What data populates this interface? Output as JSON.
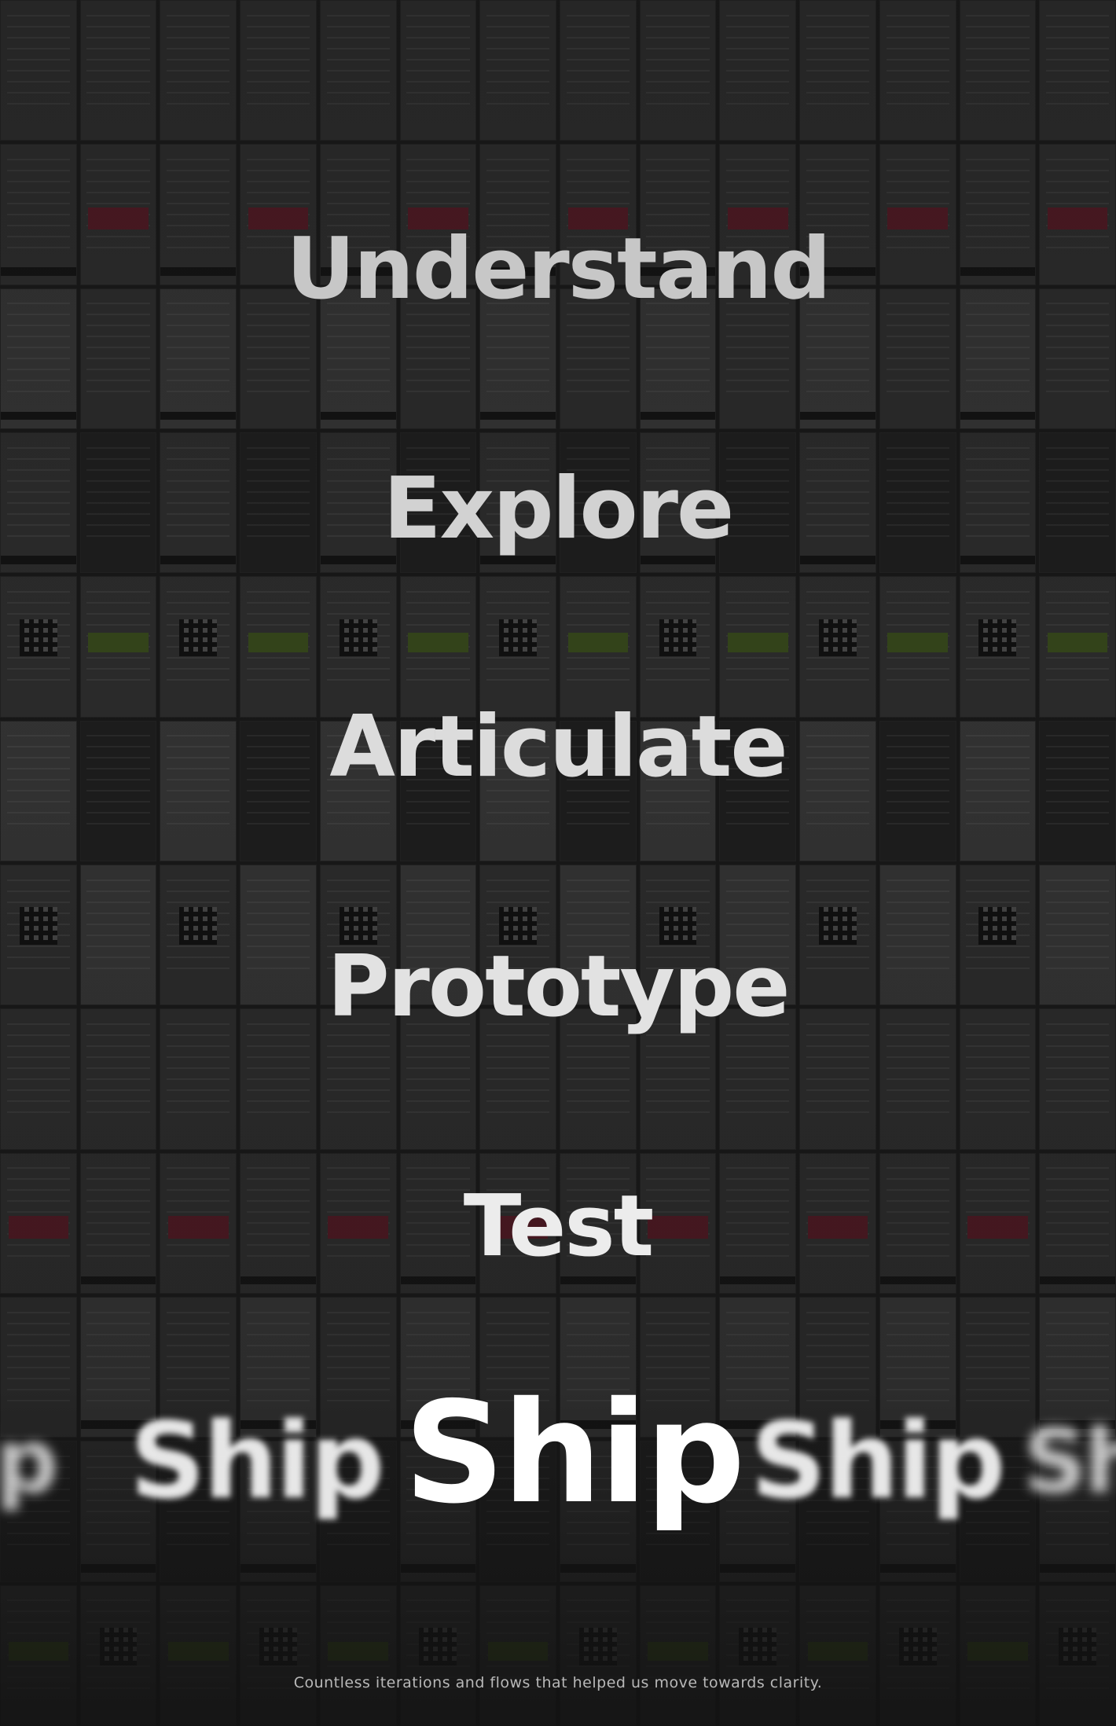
{
  "stages": [
    "Understand",
    "Explore",
    "Articulate",
    "Prototype",
    "Test"
  ],
  "ship": {
    "main": "Ship",
    "echo_near": "Ship",
    "echo_far_left": "hip",
    "echo_far_right": "Sh"
  },
  "caption": "Countless iterations and flows that helped us move towards clarity.",
  "colors": {
    "background": "#1a1a1a",
    "text": "#ffffff",
    "caption": "#b8b8b8"
  }
}
